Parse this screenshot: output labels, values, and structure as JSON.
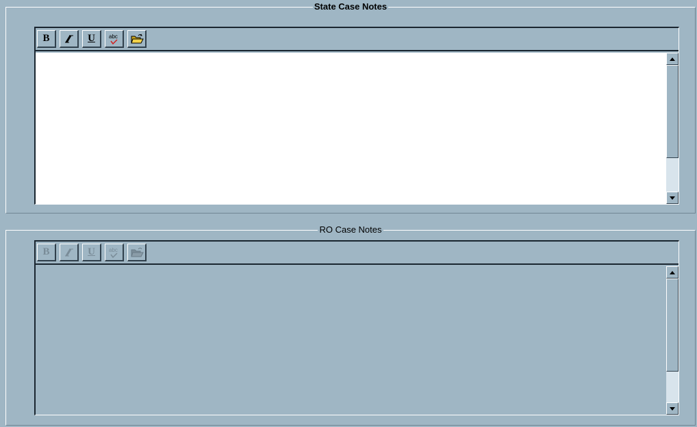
{
  "state_panel": {
    "title": "State Case Notes",
    "toolbar": {
      "bold_label": "B",
      "italic_label": "I",
      "underline_label": "U",
      "spellcheck_label": "abc",
      "open_icon": "folder-open-icon"
    },
    "editor_text": "",
    "editor_bg": "#ffffff"
  },
  "ro_panel": {
    "title": "RO Case Notes",
    "toolbar": {
      "bold_label": "B",
      "italic_label": "I",
      "underline_label": "U",
      "spellcheck_label": "abc",
      "open_icon": "folder-open-icon"
    },
    "editor_text": "",
    "editor_bg": "#9fb6c4",
    "disabled": true
  },
  "colors": {
    "background": "#9fb6c4",
    "dark_border": "#1a2630",
    "scroll_track": "#d8e4ec"
  }
}
